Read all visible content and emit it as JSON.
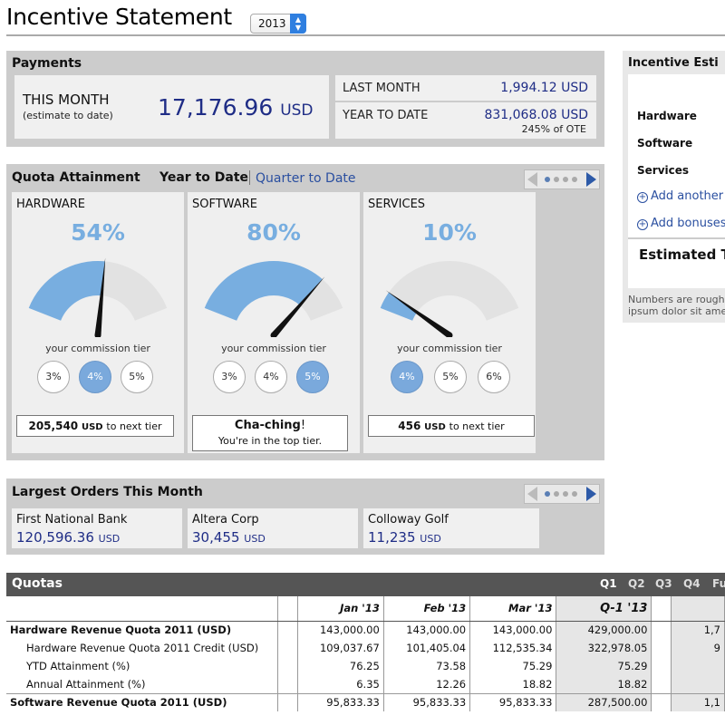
{
  "header": {
    "title": "Incentive Statement",
    "year": "2013"
  },
  "payments": {
    "title": "Payments",
    "this_month_label": "THIS MONTH",
    "this_month_sub": "(estimate to date)",
    "this_month_value": "17,176.96",
    "currency": "USD",
    "last_month_label": "LAST MONTH",
    "last_month_value": "1,994.12",
    "ytd_label": "YEAR TO DATE",
    "ytd_value": "831,068.08",
    "ytd_note": "245% of OTE"
  },
  "quota": {
    "title": "Quota Attainment",
    "tab_active": "Year to Date",
    "tab_link": "Quarter to Date",
    "tier_caption": "your commission tier",
    "cards": [
      {
        "category": "HARDWARE",
        "percent": "54%",
        "attainment": 0.54,
        "tiers": [
          "3%",
          "4%",
          "5%"
        ],
        "active_tier": 1,
        "next_value": "205,540",
        "next_unit": "USD",
        "next_suffix": "to next tier"
      },
      {
        "category": "SOFTWARE",
        "percent": "80%",
        "attainment": 0.8,
        "tiers": [
          "3%",
          "4%",
          "5%"
        ],
        "active_tier": 2,
        "top_title": "Cha-ching",
        "top_bang": "!",
        "top_sub": "You're in the top tier."
      },
      {
        "category": "SERVICES",
        "percent": "10%",
        "attainment": 0.1,
        "tiers": [
          "4%",
          "5%",
          "6%"
        ],
        "active_tier": 0,
        "next_value": "456",
        "next_unit": "USD",
        "next_suffix": "to next tier"
      }
    ]
  },
  "orders": {
    "title": "Largest Orders This Month",
    "items": [
      {
        "name": "First National Bank",
        "value": "120,596.36",
        "unit": "USD"
      },
      {
        "name": "Altera Corp",
        "value": "30,455",
        "unit": "USD"
      },
      {
        "name": "Colloway Golf",
        "value": "11,235",
        "unit": "USD"
      }
    ]
  },
  "quotas": {
    "title": "Quotas",
    "quarter_tabs": [
      "Q1",
      "Q2",
      "Q3",
      "Q4",
      "Fu"
    ],
    "columns": [
      "Jan '13",
      "Feb '13",
      "Mar '13",
      "Q-1 '13"
    ],
    "rows": [
      {
        "label": "Hardware Revenue Quota 2011 (USD)",
        "bold": true,
        "values": [
          "143,000.00",
          "143,000.00",
          "143,000.00",
          "429,000.00"
        ],
        "extra": "1,7"
      },
      {
        "label": "Hardware Revenue Quota 2011 Credit (USD)",
        "bold": false,
        "values": [
          "109,037.67",
          "101,405.04",
          "112,535.34",
          "322,978.05"
        ],
        "extra": "9"
      },
      {
        "label": "YTD Attainment (%)",
        "bold": false,
        "values": [
          "76.25",
          "73.58",
          "75.29",
          "75.29"
        ],
        "extra": ""
      },
      {
        "label": "Annual Attainment (%)",
        "bold": false,
        "values": [
          "6.35",
          "12.26",
          "18.82",
          "18.82"
        ],
        "extra": ""
      },
      {
        "label": "Software Revenue Quota 2011 (USD)",
        "bold": true,
        "values": [
          "95,833.33",
          "95,833.33",
          "95,833.33",
          "287,500.00"
        ],
        "extra": "1,1"
      }
    ]
  },
  "estimator": {
    "title": "Incentive Esti",
    "rows": [
      "Hardware",
      "Software",
      "Services"
    ],
    "add_another": "Add another",
    "add_bonuses": "Add bonuses",
    "estimated": "Estimated T",
    "note_line1": "Numbers are rough",
    "note_line2": "ipsum dolor sit ame"
  },
  "colors": {
    "accent_blue": "#1f2d86",
    "gauge_fill": "#78aee0",
    "link": "#2a4fa0"
  }
}
